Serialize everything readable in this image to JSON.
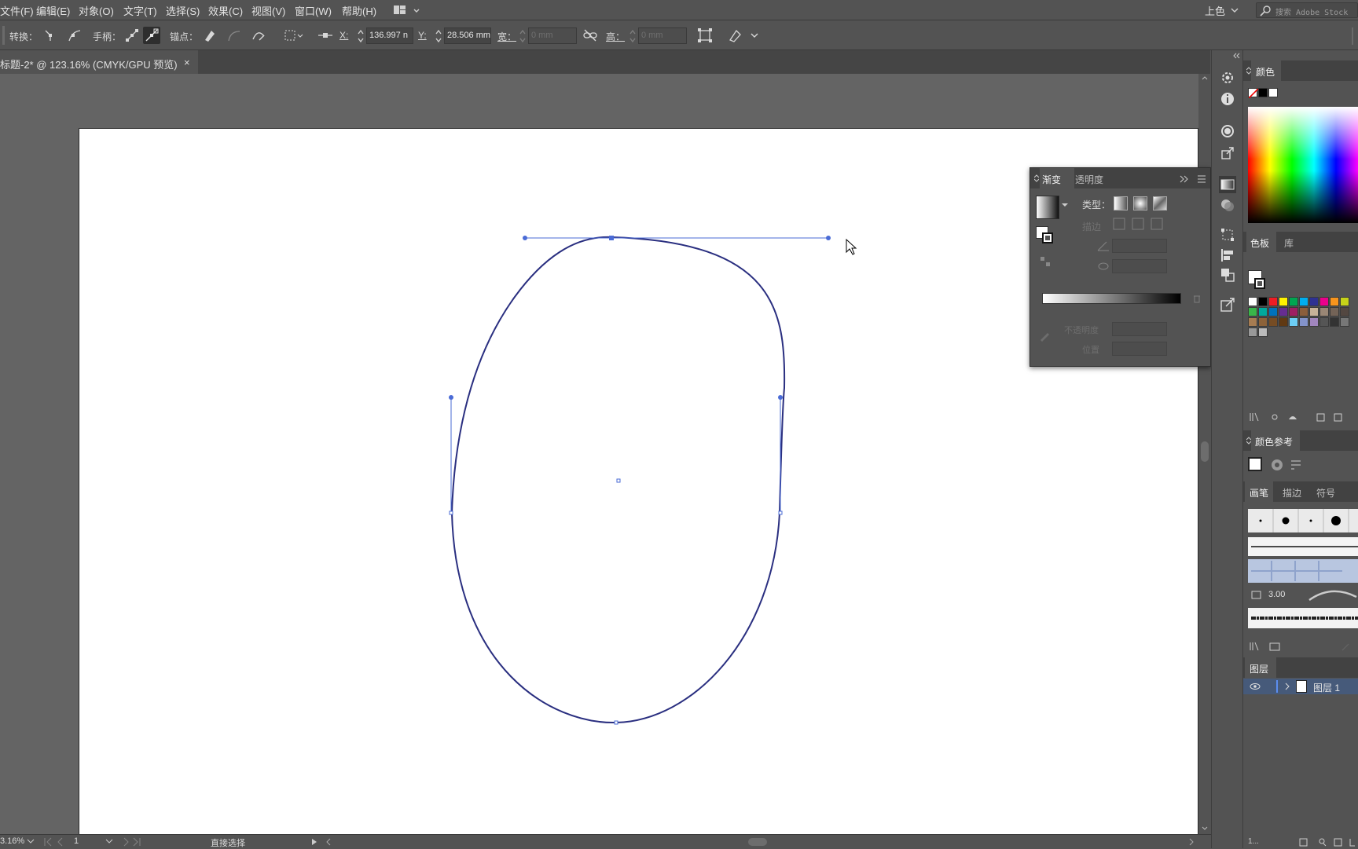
{
  "menu": {
    "items": [
      "文件(F)",
      "编辑(E)",
      "对象(O)",
      "文字(T)",
      "选择(S)",
      "效果(C)",
      "视图(V)",
      "窗口(W)",
      "帮助(H)"
    ],
    "workspace": "上色",
    "search_placeholder": "搜索 Adobe Stock"
  },
  "control": {
    "convert_label": "转换：",
    "handles_label": "手柄：",
    "anchors_label": "锚点：",
    "x_label": "X:",
    "x_value": "136.997 n",
    "y_label": "Y:",
    "y_value": "28.506 mm",
    "w_label": "宽：",
    "w_value": "0 mm",
    "h_label": "高：",
    "h_value": "0 mm"
  },
  "document": {
    "tab_title": "标题-2* @ 123.16% (CMYK/GPU 预览)",
    "close_glyph": "×"
  },
  "gradient_panel": {
    "tab_gradient": "渐变",
    "tab_transparency": "透明度",
    "type_label": "类型：",
    "stroke_label": "描边",
    "opacity_label": "不透明度",
    "location_label": "位置"
  },
  "dock": {
    "color": {
      "tab": "颜色"
    },
    "swatches": {
      "tab_swatches": "色板",
      "tab_library": "库"
    },
    "color_guide": {
      "tab": "颜色参考"
    },
    "brushes": {
      "tab_brushes": "画笔",
      "tab_stroke": "描边",
      "tab_symbols": "符号",
      "brush_size": "3.00"
    },
    "layers": {
      "tab": "图层",
      "layer_name": "图层 1",
      "footer": "1..."
    }
  },
  "status": {
    "zoom": "3.16%",
    "artboard_number": "1",
    "tool_name": "直接选择"
  },
  "colors": {
    "path_stroke": "#2a2f80",
    "selection": "#4a6bd6",
    "artboard": "#ffffff",
    "pasteboard": "#646464",
    "ui_bg": "#535353"
  },
  "swatch_palette": [
    "#ffffff",
    "#000000",
    "#ed1c24",
    "#fff200",
    "#00a651",
    "#00aeef",
    "#2e3192",
    "#ec008c",
    "#f7941d",
    "#c6d219",
    "#39b54a",
    "#00a99d",
    "#0072bc",
    "#662d91",
    "#9e1f63",
    "#8b5e3c",
    "#c7b299",
    "#998675",
    "#736357",
    "#534741",
    "#a67c52",
    "#8c6239",
    "#754c24",
    "#603913",
    "#6dcff6",
    "#8393ca",
    "#a186be",
    "#555555",
    "#333333",
    "#777777",
    "#999999",
    "#bbbbbb"
  ]
}
